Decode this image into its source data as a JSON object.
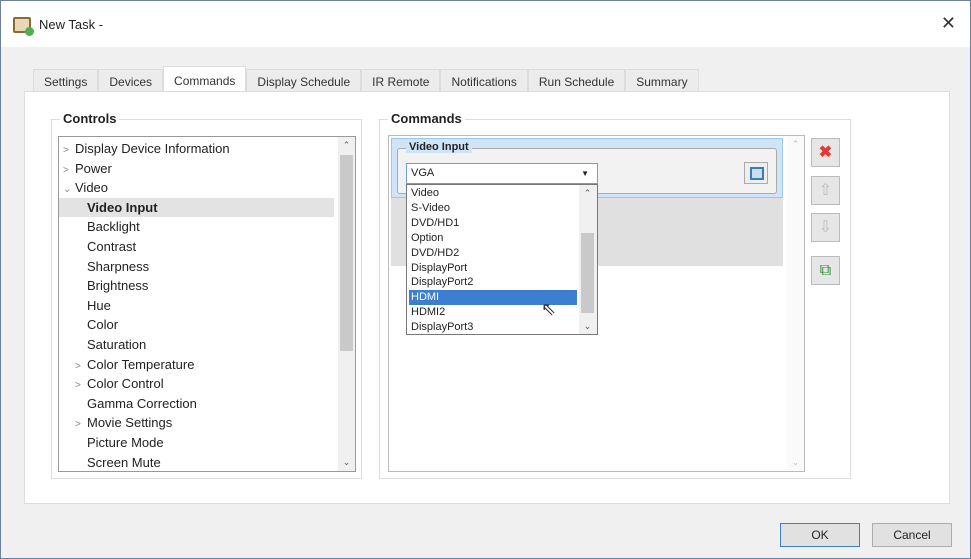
{
  "window": {
    "title": "New Task -",
    "close": "✕"
  },
  "tabs": [
    "Settings",
    "Devices",
    "Commands",
    "Display Schedule",
    "IR Remote",
    "Notifications",
    "Run Schedule",
    "Summary"
  ],
  "active_tab": "Commands",
  "controls": {
    "title": "Controls",
    "items": [
      {
        "label": "Display Device Information",
        "arrow": ">",
        "indent": 0
      },
      {
        "label": "Power",
        "arrow": ">",
        "indent": 0
      },
      {
        "label": "Video",
        "arrow": "⌄",
        "indent": 0
      },
      {
        "label": "Video Input",
        "arrow": "",
        "indent": 1,
        "selected": true
      },
      {
        "label": "Backlight",
        "arrow": "",
        "indent": 1
      },
      {
        "label": "Contrast",
        "arrow": "",
        "indent": 1
      },
      {
        "label": "Sharpness",
        "arrow": "",
        "indent": 1
      },
      {
        "label": "Brightness",
        "arrow": "",
        "indent": 1
      },
      {
        "label": "Hue",
        "arrow": "",
        "indent": 1
      },
      {
        "label": "Color",
        "arrow": "",
        "indent": 1
      },
      {
        "label": "Saturation",
        "arrow": "",
        "indent": 1
      },
      {
        "label": "Color Temperature",
        "arrow": ">",
        "indent": 1
      },
      {
        "label": "Color Control",
        "arrow": ">",
        "indent": 1
      },
      {
        "label": "Gamma Correction",
        "arrow": "",
        "indent": 1
      },
      {
        "label": "Movie Settings",
        "arrow": ">",
        "indent": 1
      },
      {
        "label": "Picture Mode",
        "arrow": "",
        "indent": 1
      },
      {
        "label": "Screen Mute",
        "arrow": "",
        "indent": 1
      }
    ]
  },
  "commands": {
    "title": "Commands",
    "group_title": "Video Input",
    "combo_value": "VGA",
    "options": [
      "Video",
      "S-Video",
      "DVD/HD1",
      "Option",
      "DVD/HD2",
      "DisplayPort",
      "DisplayPort2",
      "HDMI",
      "HDMI2",
      "DisplayPort3"
    ],
    "highlighted": "HDMI"
  },
  "footer": {
    "ok": "OK",
    "cancel": "Cancel"
  }
}
